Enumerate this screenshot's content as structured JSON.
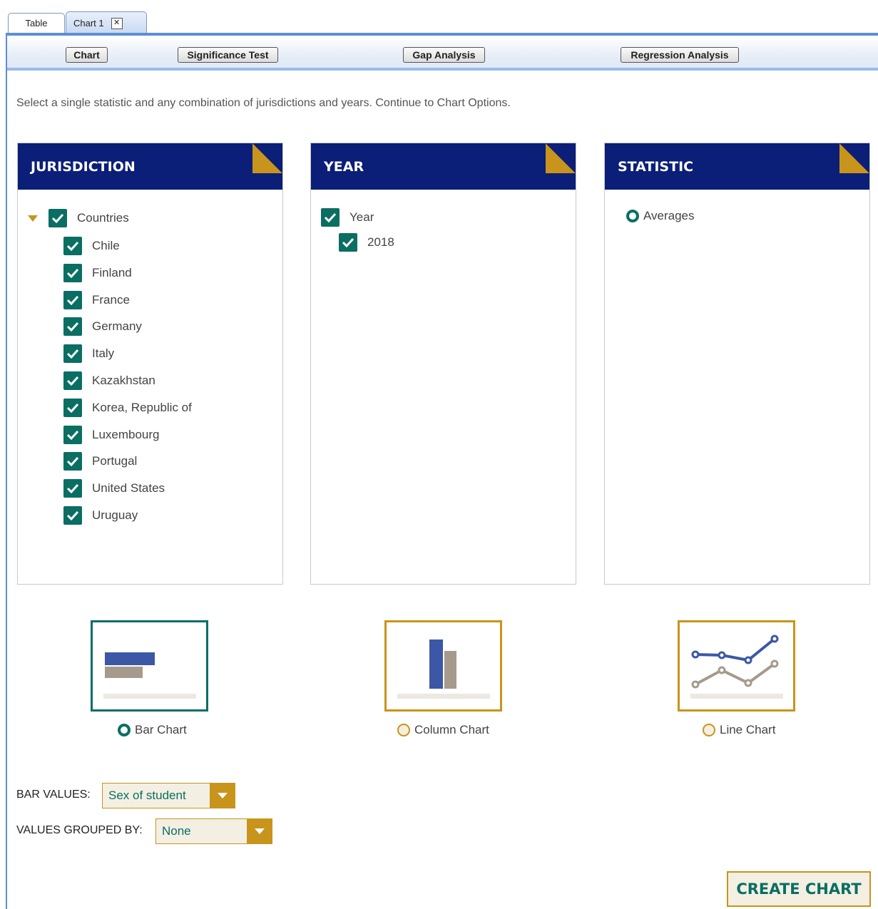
{
  "tabs": [
    {
      "label": "Table"
    },
    {
      "label": "Chart 1"
    }
  ],
  "toolbar": {
    "chart_label": "Chart",
    "significance_label": "Significance Test",
    "gap_label": "Gap Analysis",
    "regression_label": "Regression Analysis"
  },
  "intro_text": "Select a single statistic and any combination of jurisdictions and years. Continue to Chart Options.",
  "jurisdiction": {
    "title": "JURISDICTION",
    "group_label": "Countries",
    "countries": [
      "Chile",
      "Finland",
      "France",
      "Germany",
      "Italy",
      "Kazakhstan",
      "Korea, Republic of",
      "Luxembourg",
      "Portugal",
      "United States",
      "Uruguay"
    ]
  },
  "year": {
    "title": "YEAR",
    "group_label": "Year",
    "items": [
      "2018"
    ]
  },
  "statistic": {
    "title": "STATISTIC",
    "option": "Averages"
  },
  "chart_types": {
    "bar": "Bar Chart",
    "column": "Column Chart",
    "line": "Line Chart",
    "selected": "bar"
  },
  "bar_values": {
    "label": "BAR VALUES:",
    "value": "Sex of student"
  },
  "grouped_by": {
    "label": "VALUES GROUPED BY:",
    "value": "None"
  },
  "create_label": "CREATE CHART",
  "colors": {
    "navy": "#0b1e78",
    "teal": "#0a6e62",
    "gold": "#c8941b",
    "chart_blue": "#3c57a5",
    "chart_taupe": "#a59a8c"
  }
}
